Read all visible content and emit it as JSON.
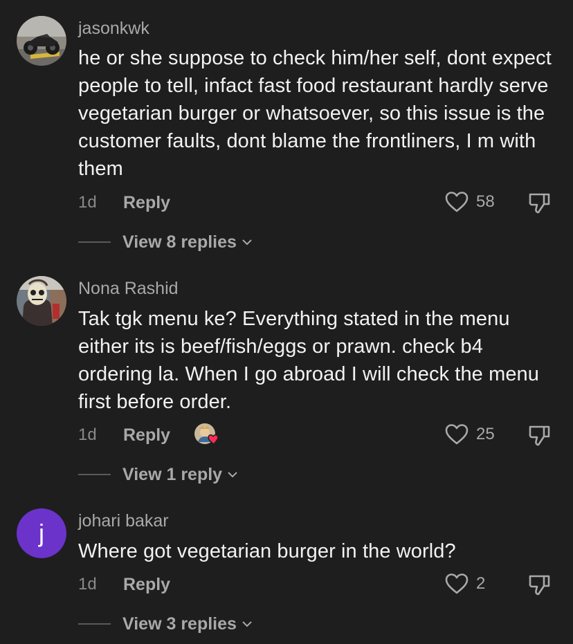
{
  "comments": [
    {
      "username": "jasonkwk",
      "text": "he or she suppose to check him/her self, dont expect people to tell, infact fast food restaurant hardly serve vegetarian burger or whatsoever, so this issue is the customer faults, dont blame the frontliners, I m with them",
      "time": "1d",
      "reply_label": "Reply",
      "likes": "58",
      "view_replies": "View 8 replies"
    },
    {
      "username": "Nona Rashid",
      "text": "Tak tgk menu ke? Everything stated in the menu either its is beef/fish/eggs or prawn. check b4 ordering la. When I go abroad I will check the menu first before order.",
      "time": "1d",
      "reply_label": "Reply",
      "likes": "25",
      "view_replies": "View 1 reply"
    },
    {
      "username": "johari bakar",
      "avatar_letter": "j",
      "text": "Where got vegetarian burger in the world?",
      "time": "1d",
      "reply_label": "Reply",
      "likes": "2",
      "view_replies": "View 3 replies"
    }
  ],
  "colors": {
    "background": "#1e1e1e",
    "username": "#a9a9a9",
    "text": "#f2f2f2",
    "muted": "#8a8a8a",
    "avatar_purple": "#6b33c9",
    "reaction_heart": "#fe2c55"
  },
  "icons": {
    "like": "heart-outline-icon",
    "dislike": "thumbs-down-icon",
    "expand": "chevron-down-icon",
    "creator_reaction": "creator-liked-heart-icon"
  }
}
